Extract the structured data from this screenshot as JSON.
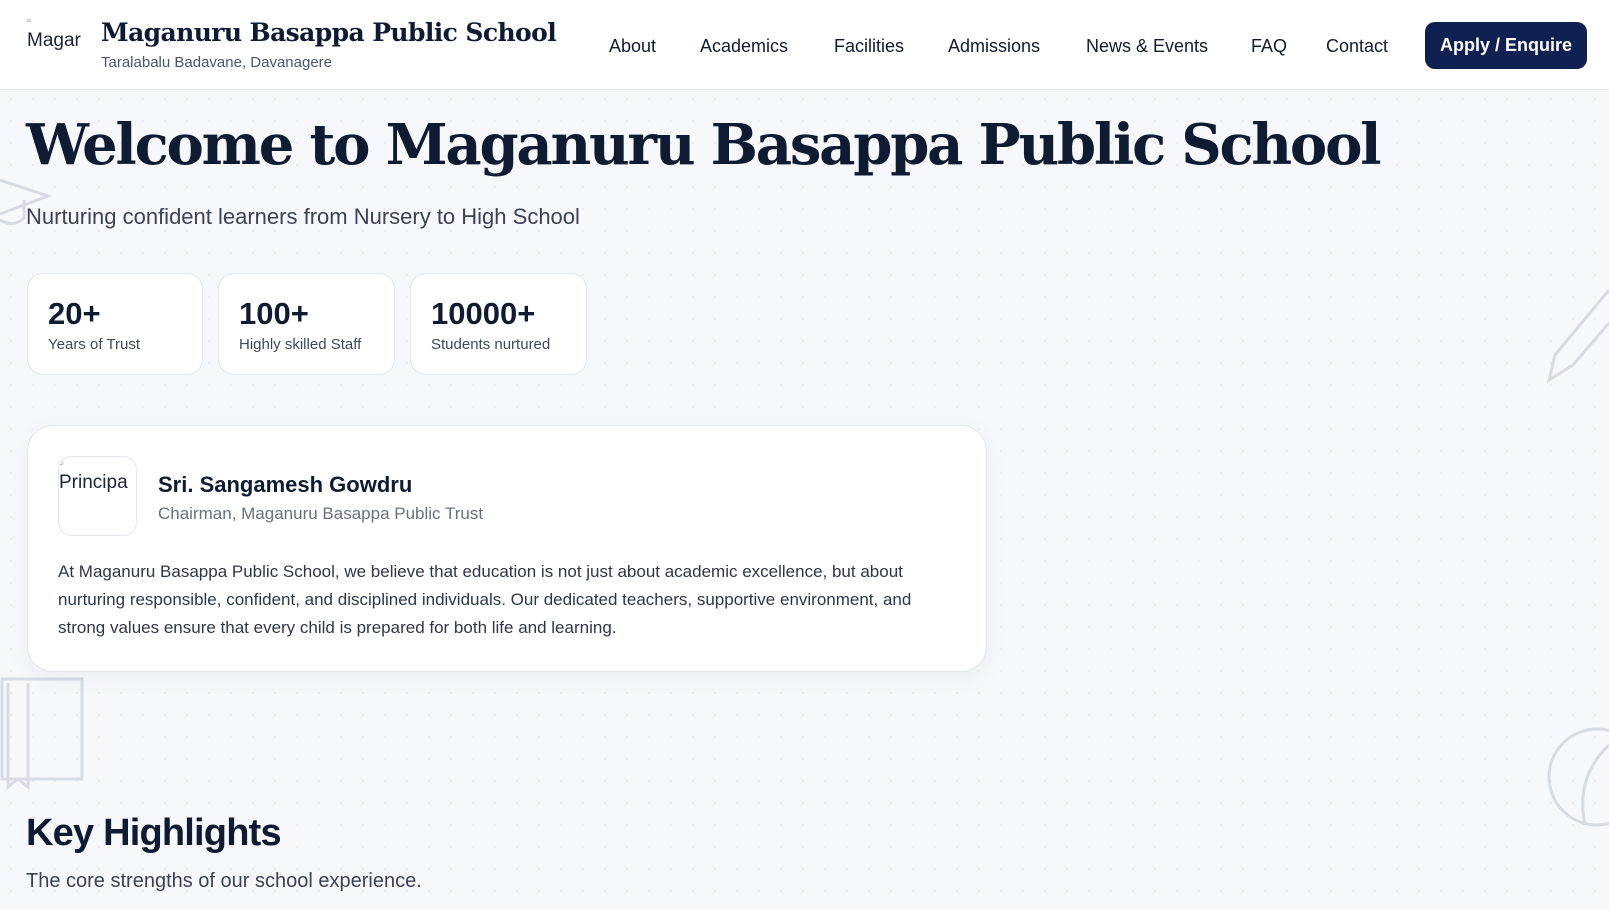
{
  "header": {
    "logo_alt": "Magar",
    "brand_title": "Maganuru Basappa Public School",
    "brand_sub": "Taralabalu Badavane, Davanagere",
    "nav": [
      {
        "label": "About"
      },
      {
        "label": "Academics"
      },
      {
        "label": "Facilities"
      },
      {
        "label": "Admissions"
      },
      {
        "label": "News & Events"
      },
      {
        "label": "FAQ"
      },
      {
        "label": "Contact"
      }
    ],
    "cta_label": "Apply / Enquire"
  },
  "hero": {
    "title": "Welcome to Maganuru Basappa Public School",
    "subtitle": "Nurturing confident learners from Nursery to High School",
    "stats": [
      {
        "value": "20+",
        "label": "Years of Trust"
      },
      {
        "value": "100+",
        "label": "Highly skilled Staff"
      },
      {
        "value": "10000+",
        "label": "Students nurtured"
      }
    ]
  },
  "chairman": {
    "avatar_alt": "Principa",
    "name": "Sri. Sangamesh Gowdru",
    "role": "Chairman, Maganuru Basappa Public Trust",
    "message": "At Maganuru Basappa Public School, we believe that education is not just about academic excellence, but about nurturing responsible, confident, and disciplined individuals. Our dedicated teachers, supportive environment, and strong values ensure that every child is prepared for both life and learning."
  },
  "highlights": {
    "title": "Key Highlights",
    "subtitle": "The core strengths of our school experience."
  },
  "colors": {
    "primary": "#0f2150",
    "text": "#0f1a33",
    "muted": "#68717f",
    "background": "#f7f8fb"
  }
}
